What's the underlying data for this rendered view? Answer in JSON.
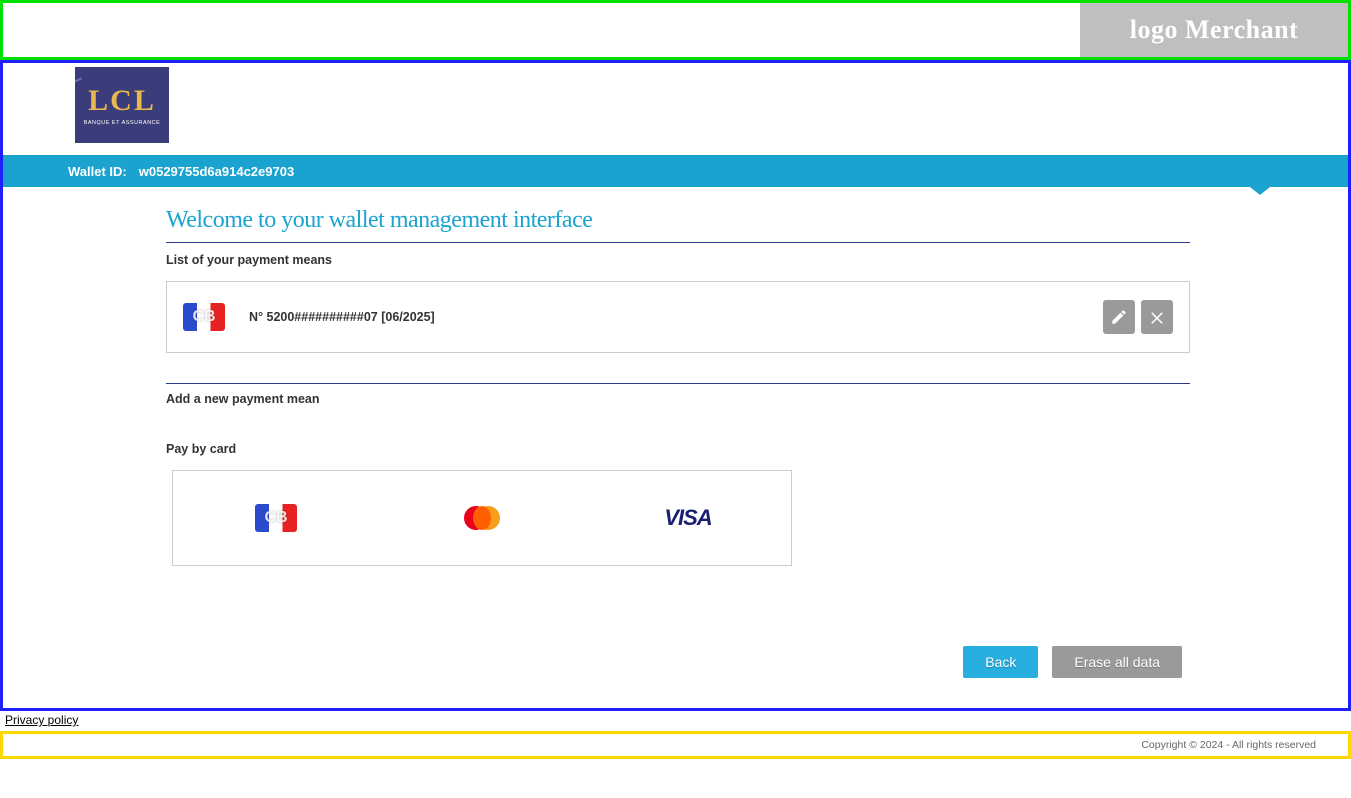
{
  "merchant": {
    "logo_text": "logo Merchant"
  },
  "bank": {
    "name": "LCL",
    "tagline": "BANQUE ET ASSURANCE"
  },
  "wallet": {
    "label": "Wallet ID:",
    "id": "w0529755d6a914c2e9703"
  },
  "page": {
    "title": "Welcome to your wallet management interface",
    "list_heading": "List of your payment means",
    "add_heading": "Add a new payment mean",
    "pay_by_card_label": "Pay by card"
  },
  "payment_means": [
    {
      "scheme": "cb",
      "display": "N° 5200##########07 [06/2025]"
    }
  ],
  "card_schemes": [
    {
      "id": "cb",
      "label": "CB"
    },
    {
      "id": "mastercard",
      "label": "Mastercard"
    },
    {
      "id": "visa",
      "label": "VISA"
    }
  ],
  "buttons": {
    "back": "Back",
    "erase_all": "Erase all data"
  },
  "links": {
    "privacy": "Privacy policy"
  },
  "footer": {
    "copyright": "Copyright © 2024 - All rights reserved"
  }
}
